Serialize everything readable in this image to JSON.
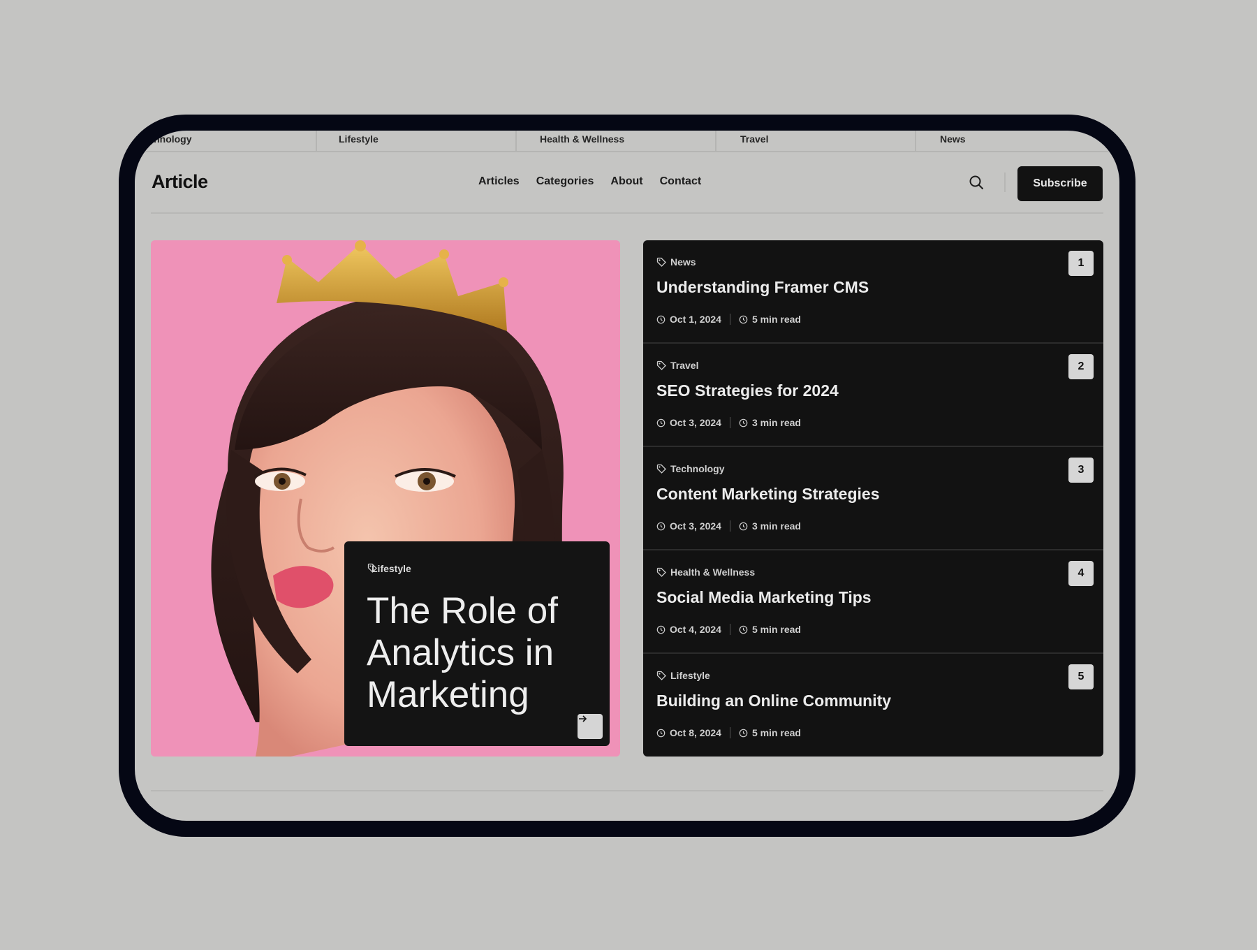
{
  "ticker": {
    "items": [
      {
        "label": "Technology"
      },
      {
        "label": "Lifestyle"
      },
      {
        "label": "Health & Wellness"
      },
      {
        "label": "Travel"
      },
      {
        "label": "News"
      }
    ]
  },
  "header": {
    "logo": "Article",
    "nav": [
      {
        "label": "Articles"
      },
      {
        "label": "Categories"
      },
      {
        "label": "About"
      },
      {
        "label": "Contact"
      }
    ],
    "search_icon": "search-icon",
    "subscribe_label": "Subscribe"
  },
  "hero": {
    "image": "portrait-with-crown",
    "category": "Lifestyle",
    "title": "The Role of Analytics in Marketing",
    "arrow_icon": "arrow-right-icon"
  },
  "articles": [
    {
      "number": "1",
      "category": "News",
      "title": "Understanding Framer CMS",
      "date": "Oct 1, 2024",
      "read_time": "5  min read"
    },
    {
      "number": "2",
      "category": "Travel",
      "title": "SEO Strategies for 2024",
      "date": "Oct 3, 2024",
      "read_time": "3 min read"
    },
    {
      "number": "3",
      "category": "Technology",
      "title": "Content Marketing Strategies",
      "date": "Oct 3, 2024",
      "read_time": "3 min read"
    },
    {
      "number": "4",
      "category": "Health & Wellness",
      "title": "Social Media Marketing Tips",
      "date": "Oct 4, 2024",
      "read_time": "5 min read"
    },
    {
      "number": "5",
      "category": "Lifestyle",
      "title": "Building an Online Community",
      "date": "Oct 8, 2024",
      "read_time": "5 min read"
    }
  ],
  "colors": {
    "page_bg": "#c5c5c3",
    "device_frame": "#050714",
    "dark_card": "#121212",
    "hero_pink": "#ef92b8"
  }
}
